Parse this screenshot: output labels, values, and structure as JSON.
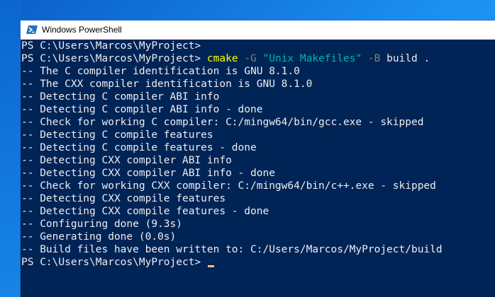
{
  "window": {
    "title": "Windows PowerShell",
    "icon": "powershell-icon"
  },
  "console": {
    "prompt_first": "PS C:\\Users\\Marcos\\MyProject>",
    "command_line": {
      "prompt": "PS C:\\Users\\Marcos\\MyProject>",
      "command": "cmake",
      "param1": "-G",
      "string1": "\"Unix Makefiles\"",
      "param2": "-B",
      "args": "build ."
    },
    "output": [
      "-- The C compiler identification is GNU 8.1.0",
      "-- The CXX compiler identification is GNU 8.1.0",
      "-- Detecting C compiler ABI info",
      "-- Detecting C compiler ABI info - done",
      "-- Check for working C compiler: C:/mingw64/bin/gcc.exe - skipped",
      "-- Detecting C compile features",
      "-- Detecting C compile features - done",
      "-- Detecting CXX compiler ABI info",
      "-- Detecting CXX compiler ABI info - done",
      "-- Check for working CXX compiler: C:/mingw64/bin/c++.exe - skipped",
      "-- Detecting CXX compile features",
      "-- Detecting CXX compile features - done",
      "-- Configuring done (9.3s)",
      "-- Generating done (0.0s)",
      "-- Build files have been written to: C:/Users/Marcos/MyProject/build"
    ],
    "prompt_last": "PS C:\\Users\\Marcos\\MyProject>"
  },
  "colors": {
    "console_bg": "#012456",
    "console_text": "#eeedf0",
    "command": "#ffff00",
    "parameter": "#808080",
    "string": "#00b4b4",
    "cursor": "#f0c090"
  }
}
